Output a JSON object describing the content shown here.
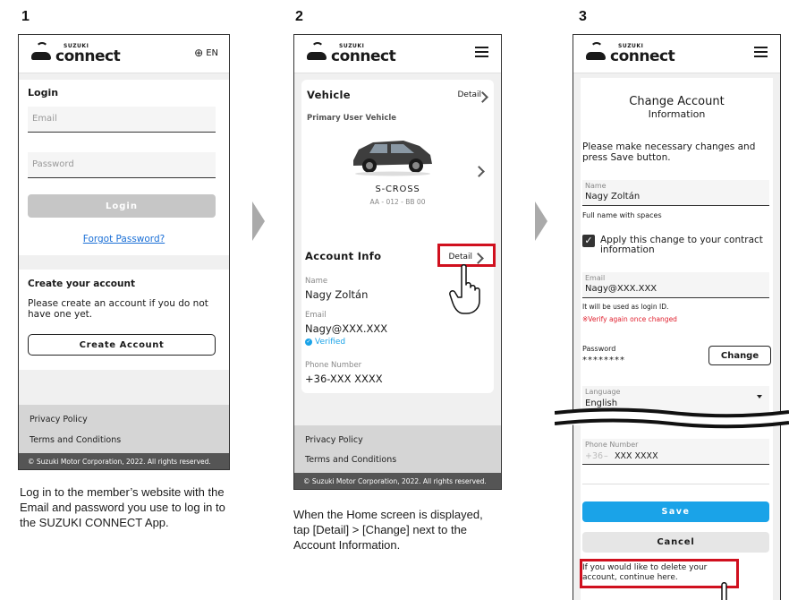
{
  "steps": [
    "1",
    "2",
    "3"
  ],
  "brand": {
    "small": "SUZUKI",
    "big": "connect"
  },
  "lang": {
    "label": "EN"
  },
  "screen1": {
    "login_title": "Login",
    "email_placeholder": "Email",
    "password_placeholder": "Password",
    "login_button": "Login",
    "forgot": "Forgot Password?",
    "create_title": "Create your account",
    "create_text": "Please create an account if you do not have one yet.",
    "create_button": "Create Account",
    "privacy": "Privacy Policy",
    "terms": "Terms and Conditions",
    "copyright": "© Suzuki Motor Corporation, 2022. All rights reserved.",
    "caption": "Log in to the member’s website with the Email and password you use to log in to the SUZUKI CONNECT App."
  },
  "screen2": {
    "vehicle_title": "Vehicle",
    "detail": "Detail",
    "primary": "Primary User Vehicle",
    "model": "S-CROSS",
    "plate": "AA - 012 - BB 00",
    "account_title": "Account Info",
    "name_label": "Name",
    "name_value": "Nagy Zoltán",
    "email_label": "Email",
    "email_value": "Nagy@XXX.XXX",
    "verified": "Verified",
    "phone_label": "Phone Number",
    "phone_value": "+36-XXX XXXX",
    "privacy": "Privacy Policy",
    "terms": "Terms and Conditions",
    "copyright": "© Suzuki Motor Corporation, 2022. All rights reserved.",
    "caption": "When the Home screen is displayed, tap [Detail] > [Change] next to the Account Information."
  },
  "screen3": {
    "title_line1": "Change Account",
    "title_line2": "Information",
    "intro": "Please make necessary changes and press Save button.",
    "name_label": "Name",
    "name_value": "Nagy Zoltán",
    "name_hint": "Full name with spaces",
    "apply_text": "Apply this change to your contract information",
    "email_label": "Email",
    "email_value": "Nagy@XXX.XXX",
    "email_hint": "It will be used as login ID.",
    "email_warn": "※Verify again once changed",
    "password_label": "Password",
    "password_value": "********",
    "change_button": "Change",
    "language_label": "Language",
    "language_value": "English",
    "phone_label": "Phone Number",
    "phone_prefix": "+36",
    "phone_value": "XXX XXXX",
    "save_button": "Save",
    "cancel_button": "Cancel",
    "delete_text": "If you would like to delete your account, continue here."
  },
  "colors": {
    "accent_blue": "#1aa3e8",
    "highlight_red": "#d0101e",
    "link_blue": "#1a6fd6"
  }
}
